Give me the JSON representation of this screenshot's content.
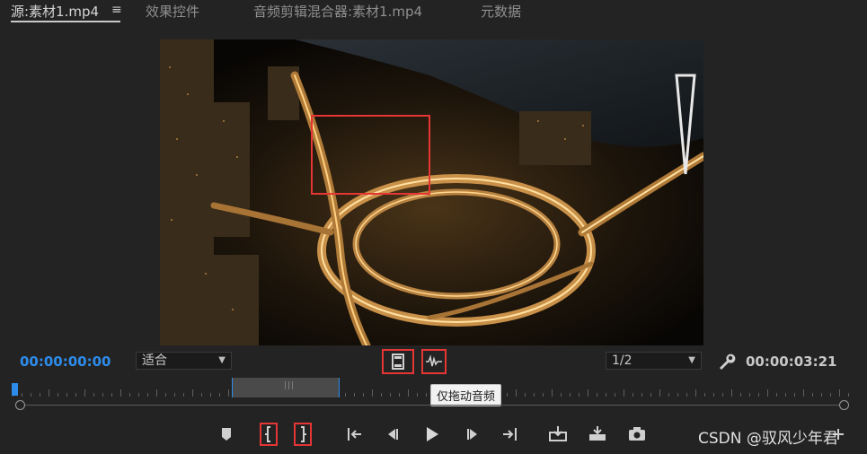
{
  "tabs": [
    {
      "label": "源:素材1.mp4",
      "active": true
    },
    {
      "label": "效果控件",
      "active": false
    },
    {
      "label": "音频剪辑混合器:素材1.mp4",
      "active": false
    },
    {
      "label": "元数据",
      "active": false
    }
  ],
  "tab_menu_symbol": "≡",
  "monitor": {
    "current_timecode": "00:00:00:00",
    "duration_timecode": "00:00:03:21",
    "zoom_select": "适合",
    "resolution_select": "1/2",
    "tooltip": "仅拖动音频",
    "in_out_marker": "|||"
  },
  "watermark": "CSDN @驭风少年君",
  "colors": {
    "accent_blue": "#2d8ceb",
    "highlight_red": "#e53535",
    "panel_bg": "#232323"
  },
  "icons": [
    "drag-video-only-icon",
    "drag-audio-only-icon",
    "settings-wrench-icon",
    "add-marker-icon",
    "mark-in-icon",
    "mark-out-icon",
    "go-to-in-icon",
    "step-back-icon",
    "play-icon",
    "step-forward-icon",
    "go-to-out-icon",
    "insert-icon",
    "overwrite-icon",
    "export-frame-icon",
    "add-button-icon"
  ]
}
